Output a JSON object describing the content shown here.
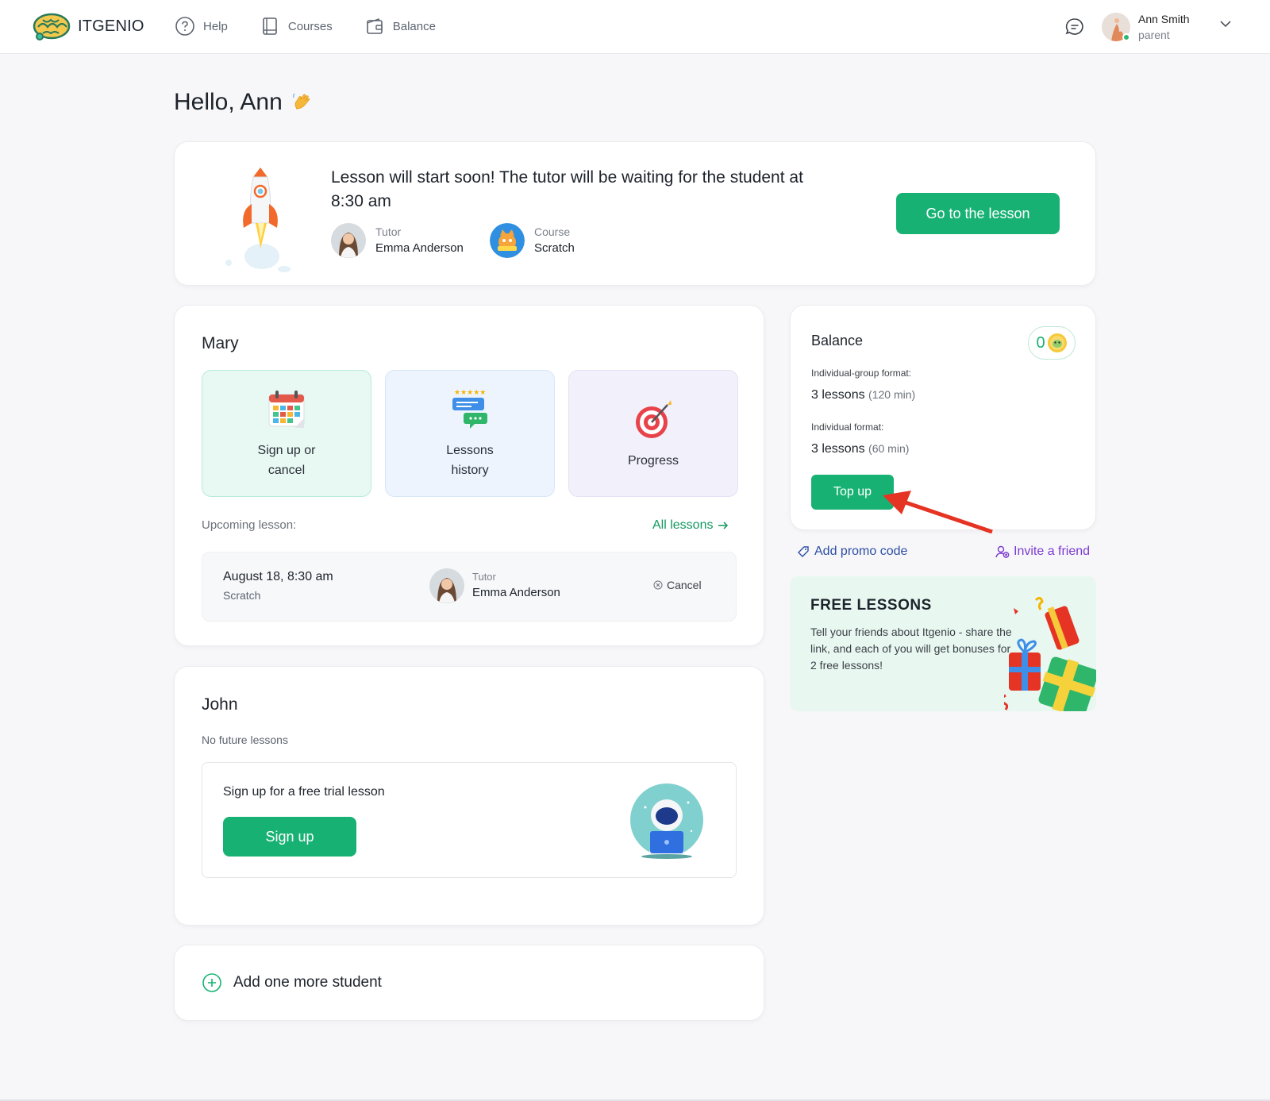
{
  "brand": {
    "name": "ITGENIO"
  },
  "nav": {
    "help": "Help",
    "courses": "Courses",
    "balance": "Balance"
  },
  "user": {
    "name": "Ann Smith",
    "role": "parent"
  },
  "greeting": "Hello, Ann",
  "banner": {
    "title": "Lesson will start soon! The tutor will be waiting for the student at 8:30 am",
    "tutor_label": "Tutor",
    "tutor_name": "Emma Anderson",
    "course_label": "Course",
    "course_name": "Scratch",
    "button": "Go to the lesson"
  },
  "mary": {
    "name": "Mary",
    "tiles": [
      "Sign up or cancel",
      "Lessons history",
      "Progress"
    ],
    "upcoming_label": "Upcoming lesson:",
    "all_lessons": "All lessons",
    "lesson": {
      "date": "August 18, 8:30 am",
      "course": "Scratch",
      "tutor_label": "Tutor",
      "tutor_name": "Emma Anderson",
      "cancel": "Cancel"
    }
  },
  "john": {
    "name": "John",
    "no_future": "No future lessons",
    "trial_title": "Sign up for a free trial lesson",
    "signup": "Sign up"
  },
  "add_student": "Add one more student",
  "balance": {
    "title": "Balance",
    "coins": "0",
    "group_label": "Individual-group format:",
    "group_value": "3 lessons",
    "group_min": "(120 min)",
    "individual_label": "Individual format:",
    "individual_value": "3 lessons",
    "individual_min": "(60 min)",
    "topup": "Top up"
  },
  "promo": "Add promo code",
  "invite": "Invite a friend",
  "free_lessons": {
    "title": "FREE LESSONS",
    "text": "Tell your friends about Itgenio - share the link, and each of you will get bonuses for 2 free lessons!"
  },
  "colors": {
    "accent": "#17b273",
    "promo": "#2c4ea3",
    "invite": "#7b3ad0",
    "arrow": "#e53424"
  }
}
